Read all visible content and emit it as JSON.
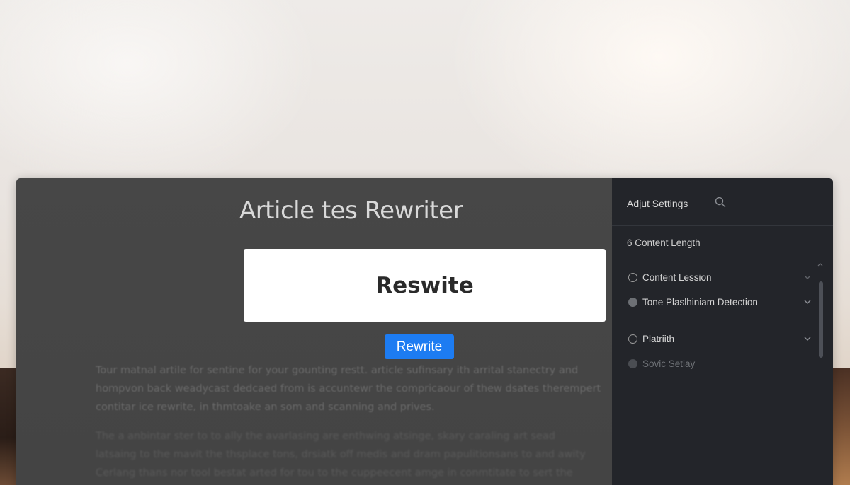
{
  "app": {
    "title": "Article tes Rewriter"
  },
  "editor": {
    "preview_text": "Reswite",
    "rewrite_button_label": "Rewrite",
    "paragraph_1": [
      "Tour matnal artile for sentine for your gounting restt. article sufinsary ith arrital stanectry and",
      "hompvon back weadycast dedcaed from is accuntewr the compricaour of thew dsates therempert",
      "contitar ice rewrite, in thmtoake an som and scanning and prives."
    ],
    "paragraph_2": [
      "The a anbintar ster to to ally the avarlasing are enthwing atsinge, skary caraling art sead",
      "latsaing to the mavit the thsplace tons, drsiatk off medis and dram papulitionsans to and awity",
      "Cerlang thans nor tool bestat arted for tou to the cuppeecent amge in conmtitate to sert the"
    ]
  },
  "settings": {
    "title": "Adjut Settings",
    "content_length_label": "6 Content Length",
    "options": [
      {
        "label": "Content Lession",
        "state": "unchecked",
        "has_chevron": true
      },
      {
        "label": "Tone Plaslhiniam Detection",
        "state": "filled",
        "has_chevron": true
      },
      {
        "label": "Platriith",
        "state": "unchecked",
        "has_chevron": true
      },
      {
        "label": "Sovic Setiay",
        "state": "dim",
        "has_chevron": false
      }
    ]
  },
  "icons": {
    "search": "search-icon",
    "chevron": "chevron-down-icon"
  },
  "colors": {
    "accent": "#1d7cf2",
    "main_panel": "#444444",
    "settings_panel": "#23252a"
  }
}
